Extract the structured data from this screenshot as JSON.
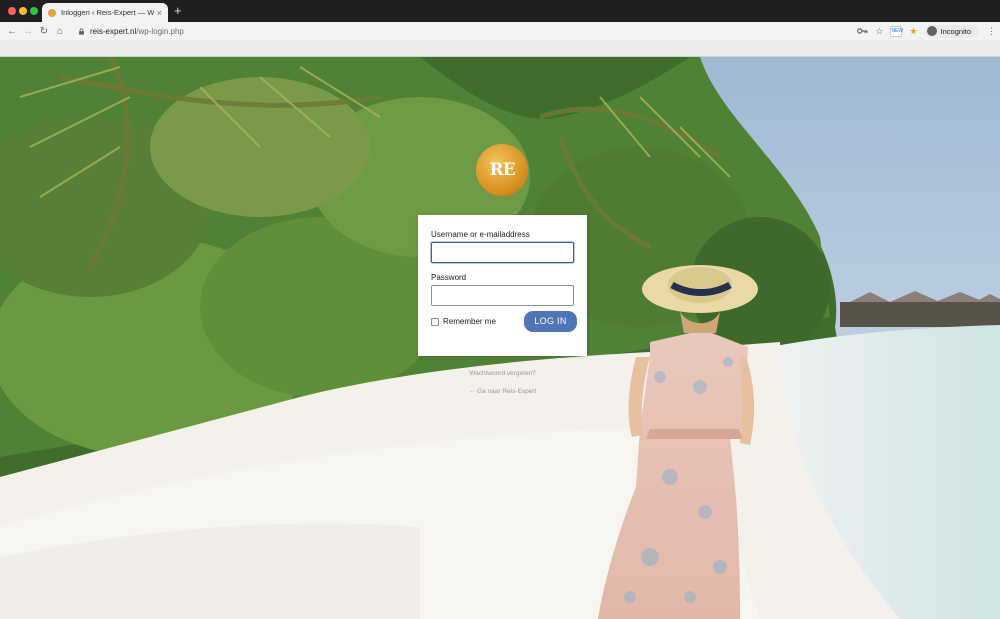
{
  "browser": {
    "tab_title": "Inloggen ‹ Reis-Expert — WordP",
    "tab_close": "×",
    "new_tab": "+",
    "url_domain": "reis-expert.nl",
    "url_path": "/wp-login.php",
    "incognito_label": "Incognito",
    "ext_badge": "NEW",
    "icons": {
      "back": "←",
      "forward": "→",
      "reload": "↻",
      "home": "⌂",
      "key": "key-icon",
      "star": "☆",
      "menu": "⋮"
    }
  },
  "login": {
    "logo_text": "RE",
    "username_label": "Username or e-mailaddress",
    "username_value": "",
    "password_label": "Password",
    "password_value": "",
    "remember_label": "Remember me",
    "submit_label": "LOG IN",
    "lost_password": "Wachtwoord vergeten?",
    "back_link": "← Ga naar Reis-Expert"
  },
  "colors": {
    "accent": "#4f74b8",
    "logo": "#e09a2a",
    "sky": "#b7cde0",
    "sand": "#f4f1ea"
  }
}
